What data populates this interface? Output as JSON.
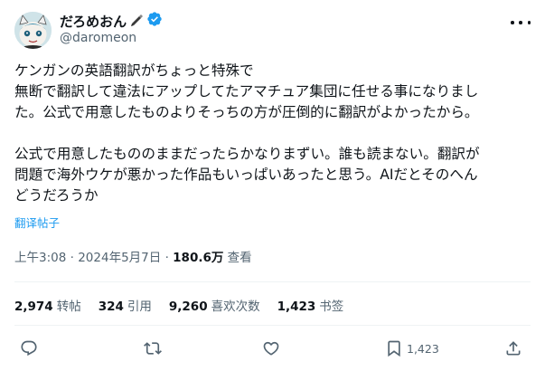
{
  "author": {
    "display_name": "だろめおん",
    "handle": "@daromeon"
  },
  "tweet": {
    "lines": [
      "ケンガンの英語翻訳がちょっと特殊で",
      "無断で翻訳して違法にアップしてたアマチュア集団に任せる事になりまし",
      "た。公式で用意したものよりそっちの方が圧倒的に翻訳がよかったから。",
      "",
      "公式で用意したもののままだったらかなりまずい。誰も読まない。翻訳が",
      "問題で海外ウケが悪かった作品もいっぱいあったと思う。AIだとそのへん",
      "どうだろうか"
    ]
  },
  "translate_label": "翻译帖子",
  "meta": {
    "time": "上午3:08",
    "sep1": "·",
    "date": "2024年5月7日",
    "sep2": "·",
    "views": "180.6万",
    "views_label": "查看"
  },
  "stats": {
    "reposts": "2,974",
    "reposts_label": "转帖",
    "quotes": "324",
    "quotes_label": "引用",
    "likes": "9,260",
    "likes_label": "喜欢次数",
    "bookmarks": "1,423",
    "bookmarks_label": "书签"
  },
  "actions": {
    "bookmark_count": "1,423"
  },
  "colors": {
    "accent": "#1d9bf0",
    "secondary_text": "#536471",
    "primary_text": "#0f1419",
    "divider": "#eff3f4"
  },
  "icons": [
    "pen-icon",
    "verified-badge-icon",
    "more-icon",
    "reply-icon",
    "repost-icon",
    "like-icon",
    "bookmark-icon",
    "share-icon"
  ]
}
